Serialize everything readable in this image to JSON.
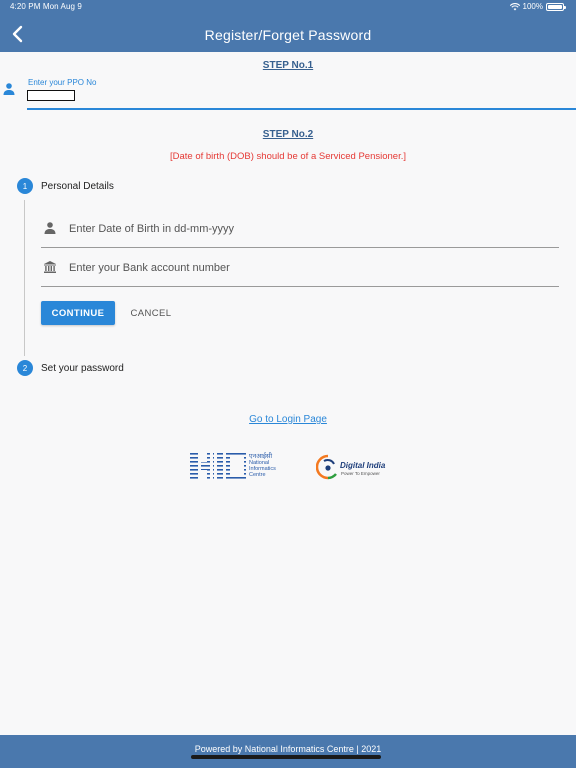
{
  "status_bar": {
    "time": "4:20 PM  Mon Aug 9",
    "battery": "100%"
  },
  "header": {
    "title": "Register/Forget Password",
    "back_icon": "chevron-left-icon"
  },
  "step1": {
    "label": "STEP No.1",
    "ppo_label": "Enter your PPO No",
    "ppo_value": "",
    "icon": "person-icon"
  },
  "step2": {
    "label": "STEP No.2",
    "warning": "[Date of birth (DOB) should be of a Serviced Pensioner.]"
  },
  "stepper": {
    "steps": [
      {
        "number": "1",
        "title": "Personal Details"
      },
      {
        "number": "2",
        "title": "Set your password"
      }
    ],
    "fields": [
      {
        "icon": "person-icon",
        "placeholder": "Enter Date of Birth in dd-mm-yyyy",
        "value": ""
      },
      {
        "icon": "bank-icon",
        "placeholder": "Enter your Bank account number",
        "value": ""
      }
    ],
    "continue_label": "CONTINUE",
    "cancel_label": "CANCEL"
  },
  "login_link": "Go to Login Page",
  "logos": {
    "nic": {
      "hindi": "एनआईसी",
      "lines": [
        "National",
        "Informatics",
        "Centre"
      ]
    },
    "digital_india": {
      "title": "Digital India",
      "tagline": "Power To Empower"
    }
  },
  "footer": {
    "text": "Powered by National Informatics Centre | 2021"
  },
  "colors": {
    "header_bg": "#4a78ad",
    "accent": "#2a87d8",
    "warning": "#e53935"
  }
}
